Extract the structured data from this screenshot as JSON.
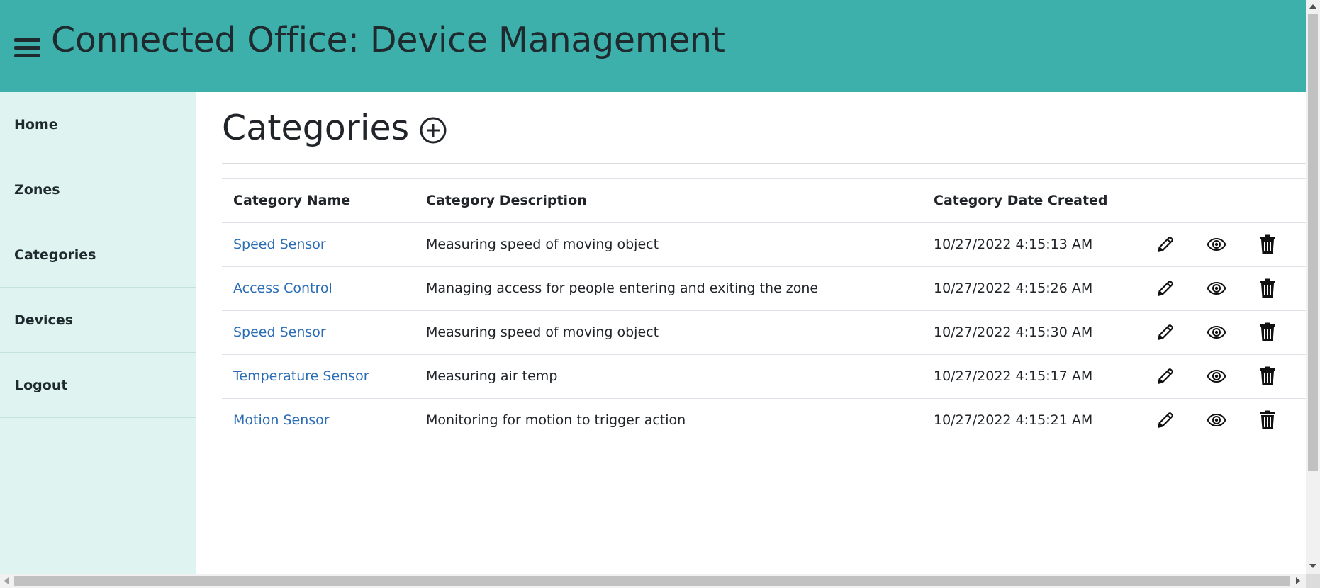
{
  "header": {
    "title": "Connected Office: Device Management",
    "menu_icon": "hamburger-menu-icon",
    "background_color": "#3eb0ab"
  },
  "sidebar": {
    "background_color": "#dff3f1",
    "items": [
      {
        "label": "Home"
      },
      {
        "label": "Zones"
      },
      {
        "label": "Categories"
      },
      {
        "label": "Devices"
      },
      {
        "label": "Logout"
      }
    ]
  },
  "main": {
    "title": "Categories",
    "add_icon": "circle-plus-icon",
    "table": {
      "headers": [
        "Category Name",
        "Category Description",
        "Category Date Created",
        ""
      ],
      "link_color": "#2a6db5",
      "row_actions": [
        "pencil-edit-icon",
        "eye-view-icon",
        "trash-delete-icon"
      ],
      "rows": [
        {
          "name": "Speed Sensor",
          "description": "Measuring speed of moving object",
          "created": "10/27/2022 4:15:13 AM"
        },
        {
          "name": "Access Control",
          "description": "Managing access for people entering and exiting the zone",
          "created": "10/27/2022 4:15:26 AM"
        },
        {
          "name": "Speed Sensor",
          "description": "Measuring speed of moving object",
          "created": "10/27/2022 4:15:30 AM"
        },
        {
          "name": "Temperature Sensor",
          "description": "Measuring air temp",
          "created": "10/27/2022 4:15:17 AM"
        },
        {
          "name": "Motion Sensor",
          "description": "Monitoring for motion to trigger action",
          "created": "10/27/2022 4:15:21 AM"
        }
      ]
    }
  }
}
